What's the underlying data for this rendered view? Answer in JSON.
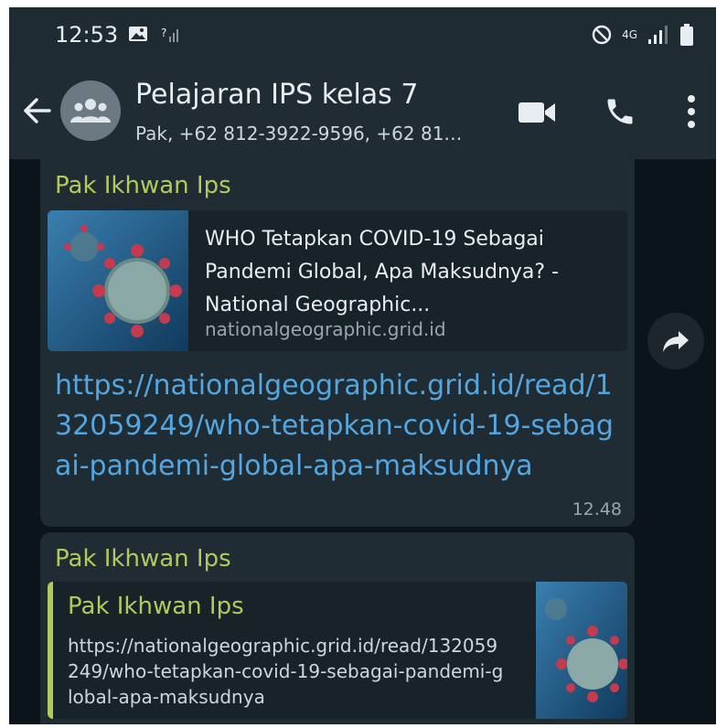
{
  "status_bar": {
    "time": "12:53",
    "network": "4G"
  },
  "header": {
    "title": "Pelajaran IPS kelas 7",
    "members": "Pak, +62 812-3922-9596, +62 81…"
  },
  "messages": [
    {
      "sender": "Pak Ikhwan Ips",
      "preview_title": "WHO Tetapkan COVID-19 Sebagai Pandemi Global, Apa Maksudnya? - National Geographic...",
      "preview_domain": "nationalgeographic.grid.id",
      "link": "https://nationalgeographic.grid.id/read/132059249/who-tetapkan-covid-19-sebagai-pandemi-global-apa-maksudnya",
      "time": "12.48"
    },
    {
      "sender": "Pak Ikhwan Ips",
      "quoted_sender": "Pak Ikhwan Ips",
      "quoted_text": "https://nationalgeographic.grid.id/read/132059249/who-tetapkan-covid-19-sebagai-pandemi-global-apa-maksudnya"
    }
  ],
  "icons": {
    "back": "arrow-left-icon",
    "avatar": "group-avatar-icon",
    "video": "video-call-icon",
    "call": "phone-icon",
    "menu": "more-vert-icon",
    "forward": "forward-icon"
  },
  "colors": {
    "sender_name": "#b4c95d",
    "link": "#53a6e0",
    "bubble": "#1f2c34",
    "background": "#0b141a"
  }
}
